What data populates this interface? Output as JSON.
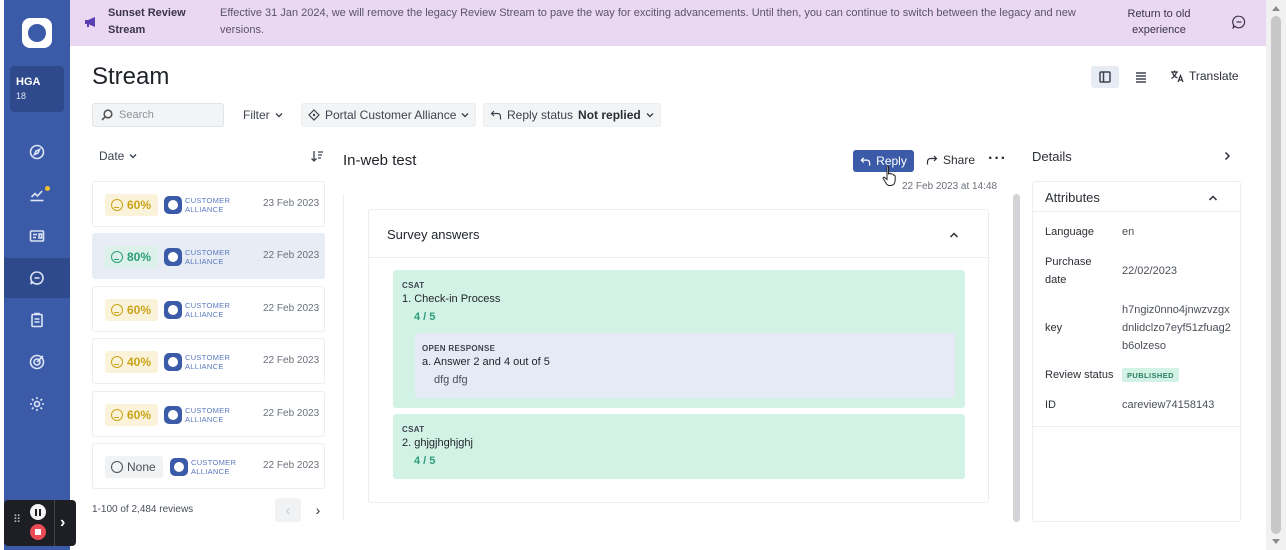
{
  "org": {
    "name": "HGA",
    "number": "18"
  },
  "banner": {
    "title": "Sunset Review Stream",
    "text": "Effective 31 Jan 2024, we will remove the legacy Review Stream to pave the way for exciting advancements. Until then, you can continue to switch between the legacy and new versions.",
    "link": "Return to old experience",
    "color": "#ead8f3"
  },
  "page": {
    "title": "Stream",
    "translate_label": "Translate"
  },
  "toolbar": {
    "search_placeholder": "Search",
    "filter_label": "Filter",
    "portal_label": "Portal Customer Alliance",
    "reply_status_label": "Reply status",
    "reply_status_value": "Not replied"
  },
  "list": {
    "sort_label": "Date",
    "logo_text": [
      "CUSTOMER",
      "ALLIANCE"
    ],
    "reviews": [
      {
        "score": "60%",
        "tone": "yellow",
        "date": "23 Feb 2023"
      },
      {
        "score": "80%",
        "tone": "green",
        "date": "22 Feb 2023"
      },
      {
        "score": "60%",
        "tone": "yellow",
        "date": "22 Feb 2023"
      },
      {
        "score": "40%",
        "tone": "yellow",
        "date": "22 Feb 2023"
      },
      {
        "score": "60%",
        "tone": "yellow",
        "date": "22 Feb 2023"
      },
      {
        "score": "None",
        "tone": "gray",
        "date": "22 Feb 2023"
      }
    ],
    "pager_text": "1-100 of 2,484 reviews"
  },
  "detail": {
    "title": "In-web test",
    "reply_label": "Reply",
    "share_label": "Share",
    "timestamp": "22 Feb 2023 at 14:48",
    "survey_title": "Survey answers",
    "q1": {
      "tag": "CSAT",
      "text": "1. Check-in Process",
      "score": "4 / 5",
      "open": {
        "tag": "OPEN RESPONSE",
        "text": "a. Answer 2 and 4 out of 5",
        "answer": "dfg dfg"
      }
    },
    "q2": {
      "tag": "CSAT",
      "text": "2. ghjgjhghjghj",
      "score": "4 / 5"
    }
  },
  "details_panel": {
    "title": "Details",
    "attributes_title": "Attributes",
    "language_label": "Language",
    "language_value": "en",
    "purchase_label": "Purchase date",
    "purchase_value": "22/02/2023",
    "key_label": "key",
    "key_value": "h7ngiz0nno4jnwzvzgxdnlidclzo7eyf51zfuag2b6olzeso",
    "status_label": "Review status",
    "status_value": "PUBLISHED",
    "id_label": "ID",
    "id_value": "careview74158143"
  },
  "colors": {
    "brand": "#3b5ba8",
    "accent_green": "#2c9e78",
    "accent_yellow": "#c9a318",
    "survey_block": "#d3f2e6"
  }
}
